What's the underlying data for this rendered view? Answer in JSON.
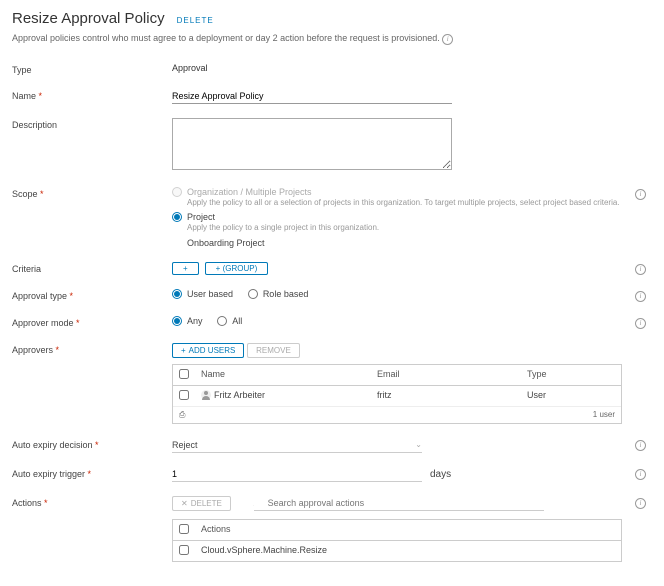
{
  "header": {
    "title": "Resize Approval Policy",
    "delete": "DELETE",
    "subtitle": "Approval policies control who must agree to a deployment or day 2 action before the request is provisioned."
  },
  "labels": {
    "type": "Type",
    "name": "Name",
    "description": "Description",
    "scope": "Scope",
    "criteria": "Criteria",
    "approvalType": "Approval type",
    "approverMode": "Approver mode",
    "approvers": "Approvers",
    "autoExpiryDecision": "Auto expiry decision",
    "autoExpiryTrigger": "Auto expiry trigger",
    "actions": "Actions"
  },
  "values": {
    "type": "Approval",
    "name": "Resize Approval Policy",
    "scopeOrg": "Organization / Multiple Projects",
    "scopeOrgHint": "Apply the policy to all or a selection of projects in this organization. To target multiple projects, select project based criteria.",
    "scopeProject": "Project",
    "scopeProjectHint": "Apply the policy to a single project in this organization.",
    "projectName": "Onboarding Project",
    "userBased": "User based",
    "roleBased": "Role based",
    "any": "Any",
    "all": "All",
    "addUsers": "ADD USERS",
    "remove": "REMOVE",
    "tableName": "Name",
    "tableEmail": "Email",
    "tableType": "Type",
    "approverName": "Fritz Arbeiter",
    "approverEmail": "fritz",
    "approverType": "User",
    "userCount": "1 user",
    "reject": "Reject",
    "triggerVal": "1",
    "days": "days",
    "deleteBtn": "DELETE",
    "searchPlaceholder": "Search approval actions",
    "actionsCol": "Actions",
    "actionRow": "Cloud.vSphere.Machine.Resize",
    "critPlus": "+",
    "critGroup": "+ (GROUP)"
  }
}
